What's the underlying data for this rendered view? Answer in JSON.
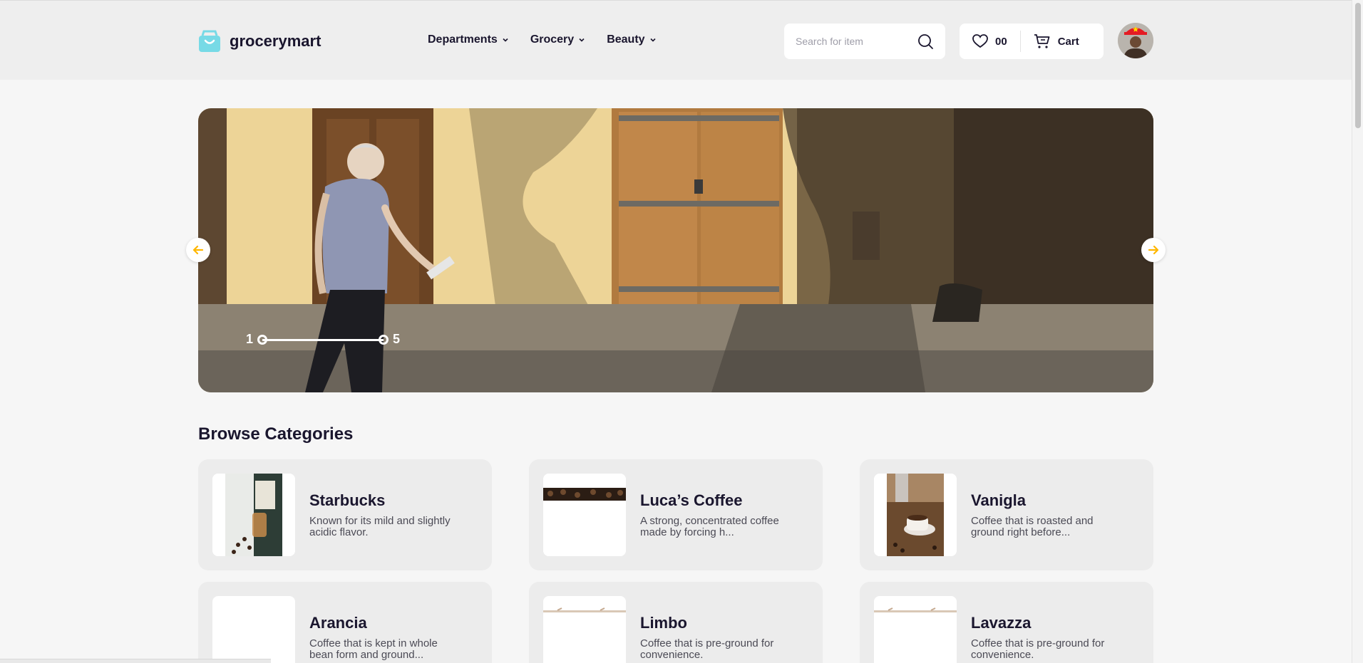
{
  "brand": {
    "name": "grocerymart"
  },
  "nav": [
    {
      "label": "Departments"
    },
    {
      "label": "Grocery"
    },
    {
      "label": "Beauty"
    }
  ],
  "search": {
    "placeholder": "Search for item"
  },
  "actions": {
    "favorites_count": "00",
    "cart_label": "Cart"
  },
  "hero": {
    "slide_start": "1",
    "slide_end": "5"
  },
  "section": {
    "title": "Browse Categories"
  },
  "categories": [
    {
      "title": "Starbucks",
      "desc": "Known for its mild and slightly acidic flavor."
    },
    {
      "title": "Luca’s Coffee",
      "desc": "A strong, concentrated coffee made by forcing h..."
    },
    {
      "title": "Vanigla",
      "desc": "Coffee that is roasted and ground right before..."
    },
    {
      "title": "Arancia",
      "desc": "Coffee that is kept in whole bean form and ground..."
    },
    {
      "title": "Limbo",
      "desc": "Coffee that is pre-ground for convenience."
    },
    {
      "title": "Lavazza",
      "desc": "Coffee that is pre-ground for convenience."
    }
  ],
  "colors": {
    "accent": "#ffb700",
    "logo": "#77dae6",
    "text": "#1a162e"
  }
}
